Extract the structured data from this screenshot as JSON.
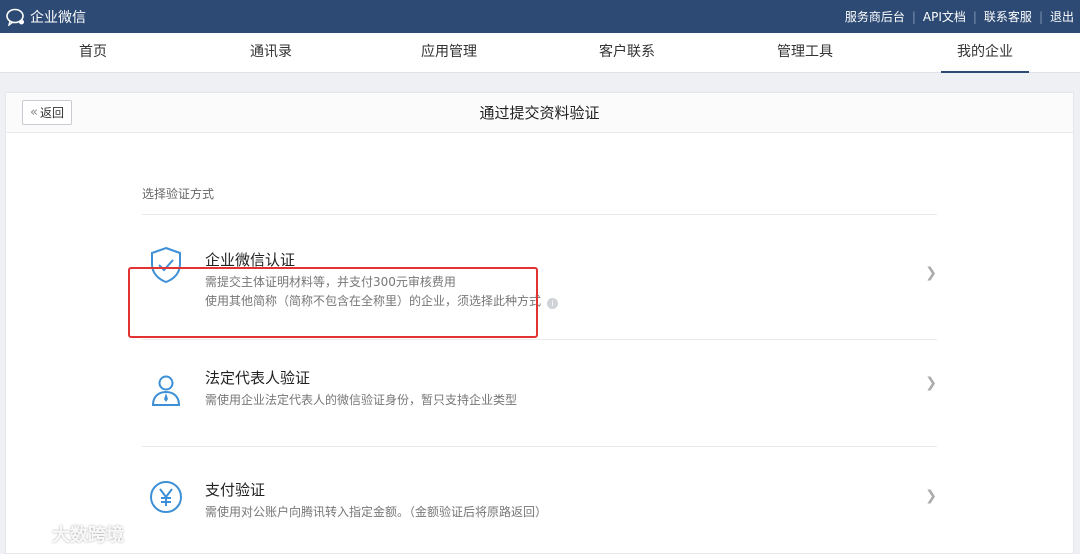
{
  "app": {
    "brand": "企业微信",
    "top_links": [
      "服务商后台",
      "API文档",
      "联系客服",
      "退出"
    ]
  },
  "nav": {
    "items": [
      "首页",
      "通讯录",
      "应用管理",
      "客户联系",
      "管理工具",
      "我的企业"
    ],
    "active": "我的企业"
  },
  "page": {
    "back_label": "返回",
    "title": "通过提交资料验证",
    "section_label": "选择验证方式"
  },
  "options": [
    {
      "title": "企业微信认证",
      "desc_lines": [
        "需提交主体证明材料等，并支付300元审核费用",
        "使用其他简称（简称不包含在全称里）的企业，须选择此种方式"
      ],
      "icon": "shield-check-icon"
    },
    {
      "title": "法定代表人验证",
      "desc_lines": [
        "需使用企业法定代表人的微信验证身份，暂只支持企业类型"
      ],
      "icon": "person-icon"
    },
    {
      "title": "支付验证",
      "desc_lines": [
        "需使用对公账户向腾讯转入指定金额。（金额验证后将原路返回）"
      ],
      "icon": "yen-icon"
    }
  ],
  "watermark": "大数跨境",
  "colors": {
    "topbar": "#2c4a73",
    "accent_icon": "#3d8fd6",
    "highlight": "#e23333"
  }
}
